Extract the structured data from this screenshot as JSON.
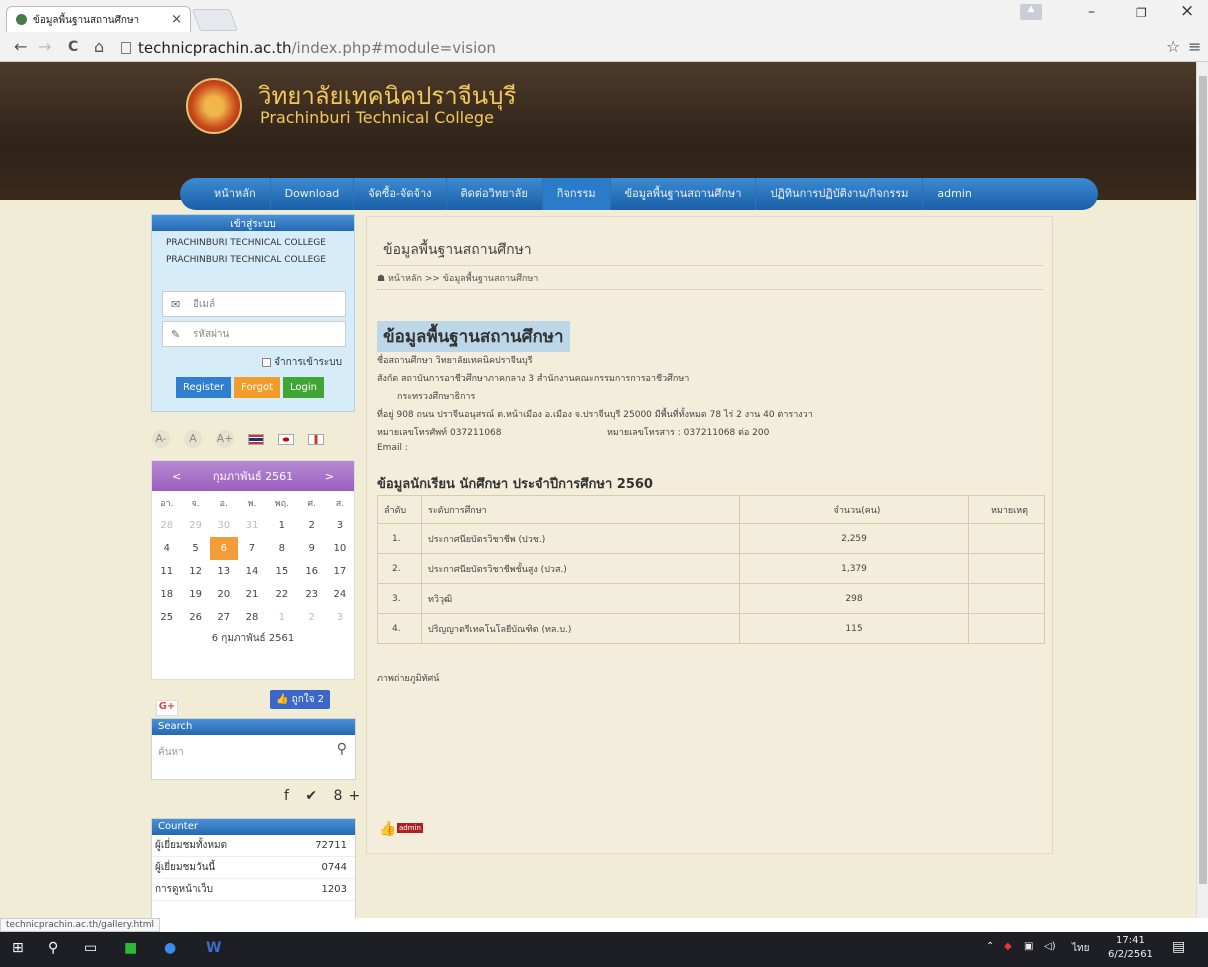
{
  "browser": {
    "tab_title": "ข้อมูลพื้นฐานสถานศึกษา",
    "close_glyph": "×",
    "url_host": "technicprachin.ac.th",
    "url_path": "/index.php#module=vision",
    "back_glyph": "←",
    "forward_glyph": "→",
    "reload_glyph": "C",
    "home_glyph": "⌂",
    "star_glyph": "☆",
    "menu_glyph": "≡",
    "min_glyph": "–",
    "max_glyph": "❐",
    "close_win_glyph": "×"
  },
  "site": {
    "title_th": "วิทยาลัยเทคนิคปราจีนบุรี",
    "title_en": "Prachinburi Technical College",
    "nav": [
      "หน้าหลัก",
      "Download",
      "จัดซื้อ-จัดจ้าง",
      "ติดต่อวิทยาลัย",
      "กิจกรรม",
      "ข้อมูลพื้นฐานสถานศึกษา",
      "ปฏิทินการปฏิบัติงาน/กิจกรรม",
      "admin"
    ]
  },
  "login": {
    "heading": "เข้าสู่ระบบ",
    "line1": "PRACHINBURI TECHNICAL COLLEGE",
    "line2": "PRACHINBURI TECHNICAL COLLEGE",
    "email_placeholder": "อีเมล์",
    "password_placeholder": "รหัสผ่าน",
    "remember": "จำการเข้าระบบ",
    "register": "Register",
    "forgot": "Forgot",
    "login": "Login"
  },
  "fontsize": {
    "small": "A-",
    "normal": "A",
    "large": "A+"
  },
  "calendar": {
    "prev": "<",
    "next": ">",
    "month": "กุมภาพันธ์ 2561",
    "weekdays": [
      "อา.",
      "จ.",
      "อ.",
      "พ.",
      "พฤ.",
      "ศ.",
      "ส."
    ],
    "weeks": [
      [
        "28",
        "29",
        "30",
        "31",
        "1",
        "2",
        "3"
      ],
      [
        "4",
        "5",
        "6",
        "7",
        "8",
        "9",
        "10"
      ],
      [
        "11",
        "12",
        "13",
        "14",
        "15",
        "16",
        "17"
      ],
      [
        "18",
        "19",
        "20",
        "21",
        "22",
        "23",
        "24"
      ],
      [
        "25",
        "26",
        "27",
        "28",
        "1",
        "2",
        "3"
      ]
    ],
    "footer": "6 กุมภาพันธ์ 2561"
  },
  "social": {
    "gplus": "G+",
    "like": "ถูกใจ 2",
    "icons": "f ✔ 8+"
  },
  "search": {
    "heading": "Search",
    "placeholder": "ค้นหา",
    "icon": "⚲"
  },
  "counter": {
    "heading": "Counter",
    "rows": [
      {
        "label": "ผู้เยี่ยมชมทั้งหมด",
        "value": "72711"
      },
      {
        "label": "ผู้เยี่ยมชมวันนี้",
        "value": "0744"
      },
      {
        "label": "การดูหน้าเว็บ",
        "value": "1203"
      }
    ]
  },
  "content": {
    "title": "ข้อมูลพื้นฐานสถานศึกษา",
    "breadcrumb": "หน้าหลัก >> ข้อมูลพื้นฐานสถานศึกษา",
    "heading": "ข้อมูลพื้นฐานสถานศึกษา",
    "school": "ชื่อสถานศึกษา วิทยาลัยเทคนิคปราจีนบุรี",
    "affiliation": "สังกัด สถาบันการอาชีวศึกษาภาคกลาง 3 สำนักงานคณะกรรมการการอาชีวศึกษา",
    "ministry": "กระทรวงศึกษาธิการ",
    "address": "ที่อยู่ 908 ถนน ปราจีนอนุสรณ์ ต.หน้าเมือง อ.เมือง จ.ปราจีนบุรี 25000 มีพื้นที่ทั้งหมด 78 ไร่ 2 งาน 40 ตารางวา",
    "phone": "หมายเลขโทรศัพท์ 037211068",
    "fax": "หมายเลขโทรสาร : 037211068 ต่อ 200",
    "email": "Email :",
    "students_heading": "ข้อมูลนักเรียน นักศึกษา ประจำปีการศึกษา 2560",
    "table_headers": [
      "ลำดับ",
      "ระดับการศึกษา",
      "จำนวน(คน)",
      "หมายเหตุ"
    ],
    "table_rows": [
      {
        "no": "1.",
        "level": "ประกาศนียบัตรวิชาชีพ (ปวช.)",
        "count": "2,259",
        "note": ""
      },
      {
        "no": "2.",
        "level": "ประกาศนียบัตรวิชาชีพชั้นสูง (ปวส.)",
        "count": "1,379",
        "note": ""
      },
      {
        "no": "3.",
        "level": "ทวิวุฒิ",
        "count": "298",
        "note": ""
      },
      {
        "no": "4.",
        "level": "ปริญญาตรีเทคโนโลยีบัณฑิต (ทล.บ.)",
        "count": "115",
        "note": ""
      }
    ],
    "photos": "ภาพถ่ายภูมิทัศน์",
    "admin_badge": "admin"
  },
  "status_url": "technicprachin.ac.th/gallery.html",
  "taskbar": {
    "clock_time": "17:41",
    "clock_date": "6/2/2561",
    "lang": "ไทย"
  }
}
